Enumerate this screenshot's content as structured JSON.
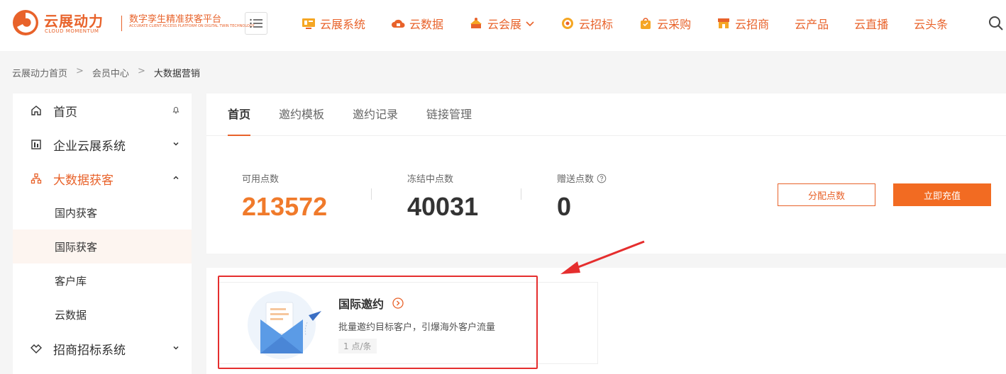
{
  "header": {
    "logo_cn": "云展动力",
    "logo_en": "CLOUD MOMENTUM",
    "slogan": "数字孪生精准获客平台",
    "slogan_en": "ACCURATE CLIENT ACCESS PLATFORM ON DIGITAL TWIN TECHNOLOGY",
    "nav": [
      {
        "label": "云展系统",
        "icon": "monitor-icon"
      },
      {
        "label": "云数据",
        "icon": "cloud-icon"
      },
      {
        "label": "云会展",
        "icon": "exhibition-icon"
      },
      {
        "label": "云招标",
        "icon": "target-icon"
      },
      {
        "label": "云采购",
        "icon": "bag-icon"
      },
      {
        "label": "云招商",
        "icon": "store-icon"
      },
      {
        "label": "云产品"
      },
      {
        "label": "云直播"
      },
      {
        "label": "云头条"
      }
    ],
    "accent": "#e8622a"
  },
  "breadcrumb": {
    "items": [
      "云展动力首页",
      "会员中心",
      "大数据营销"
    ],
    "sep": ">"
  },
  "sidebar": {
    "items": [
      {
        "label": "首页",
        "icon": "home-icon"
      },
      {
        "label": "企业云展系统",
        "icon": "building-icon"
      },
      {
        "label": "大数据获客",
        "icon": "network-icon"
      },
      {
        "label": "招商招标系统",
        "icon": "handshake-icon"
      }
    ],
    "sub": [
      "国内获客",
      "国际获客",
      "客户库",
      "云数据"
    ]
  },
  "tabs": [
    "首页",
    "邀约模板",
    "邀约记录",
    "链接管理"
  ],
  "stats": {
    "available_label": "可用点数",
    "available_value": "213572",
    "frozen_label": "冻结中点数",
    "frozen_value": "40031",
    "gift_label": "赠送点数",
    "gift_value": "0"
  },
  "buttons": {
    "allocate": "分配点数",
    "recharge": "立即充值"
  },
  "card": {
    "title": "国际邀约",
    "desc": "批量邀约目标客户，引爆海外客户流量",
    "tag": "1 点/条"
  }
}
